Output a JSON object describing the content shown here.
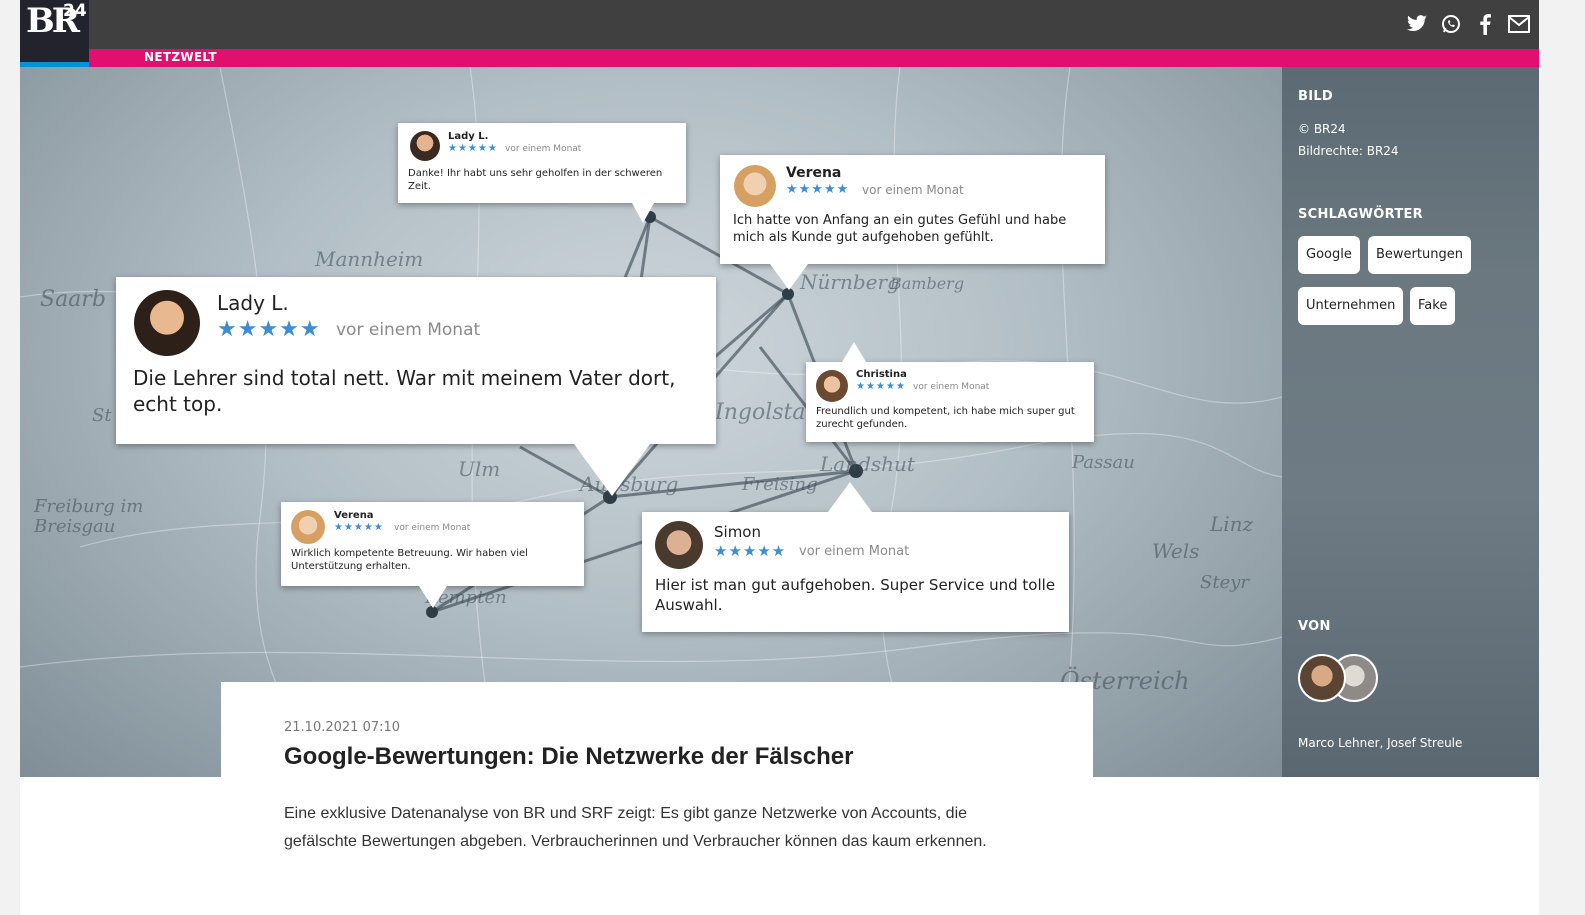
{
  "brand": {
    "logo_text": "BR",
    "logo_number": "24",
    "category": "NETZWELT"
  },
  "social_icons": [
    "twitter-icon",
    "whatsapp-icon",
    "facebook-icon",
    "mail-icon"
  ],
  "colors": {
    "topbar": "#404040",
    "category_bar": "#e1106f",
    "logo_stripe": "#0092d8",
    "stars": "#3d8dd0"
  },
  "map_cities": [
    "Mannheim",
    "Saarb",
    "Nürnberg",
    "Bamberg",
    "Ingolsta",
    "Ulm",
    "Augsburg",
    "Freising",
    "Landshut",
    "Passau",
    "Freiburg im Breisgau",
    "Linz",
    "Wels",
    "Steyr",
    "Kempten",
    "Österreich",
    "St"
  ],
  "reviews": [
    {
      "name": "Lady L.",
      "stars": "★★★★★",
      "time": "vor einem Monat",
      "text": "Danke! Ihr habt uns sehr geholfen in der schweren Zeit."
    },
    {
      "name": "Verena",
      "stars": "★★★★★",
      "time": "vor einem Monat",
      "text": "Ich hatte von Anfang an ein gutes Gefühl und habe mich als Kunde gut aufgehoben gefühlt."
    },
    {
      "name": "Lady L.",
      "stars": "★★★★★",
      "time": "vor einem Monat",
      "text": "Die Lehrer sind total nett. War mit meinem Vater dort, echt top."
    },
    {
      "name": "Christina",
      "stars": "★★★★★",
      "time": "vor einem Monat",
      "text": "Freundlich und kompetent, ich habe mich super gut zurecht gefunden."
    },
    {
      "name": "Verena",
      "stars": "★★★★★",
      "time": "vor einem Monat",
      "text": "Wirklich kompetente Betreuung. Wir haben viel Unterstützung erhalten."
    },
    {
      "name": "Simon",
      "stars": "★★★★★",
      "time": "vor einem Monat",
      "text": "Hier ist man gut aufgehoben. Super Service und tolle Auswahl."
    }
  ],
  "sidebar": {
    "bild_heading": "BILD",
    "copyright": "© BR24",
    "rights": "Bildrechte: BR24",
    "tags_heading": "SCHLAGWÖRTER",
    "tags": [
      "Google",
      "Bewertungen",
      "Unternehmen",
      "Fake"
    ],
    "von_heading": "VON",
    "authors": "Marco Lehner, Josef Streule"
  },
  "article": {
    "date": "21.10.2021 07:10",
    "title": "Google-Bewertungen: Die Netzwerke der Fälscher",
    "lead": "Eine exklusive Datenanalyse von BR und SRF zeigt: Es gibt ganze Netzwerke von Accounts, die gefälschte Bewertungen abgeben. Verbraucherinnen und Verbraucher können das kaum erkennen."
  }
}
